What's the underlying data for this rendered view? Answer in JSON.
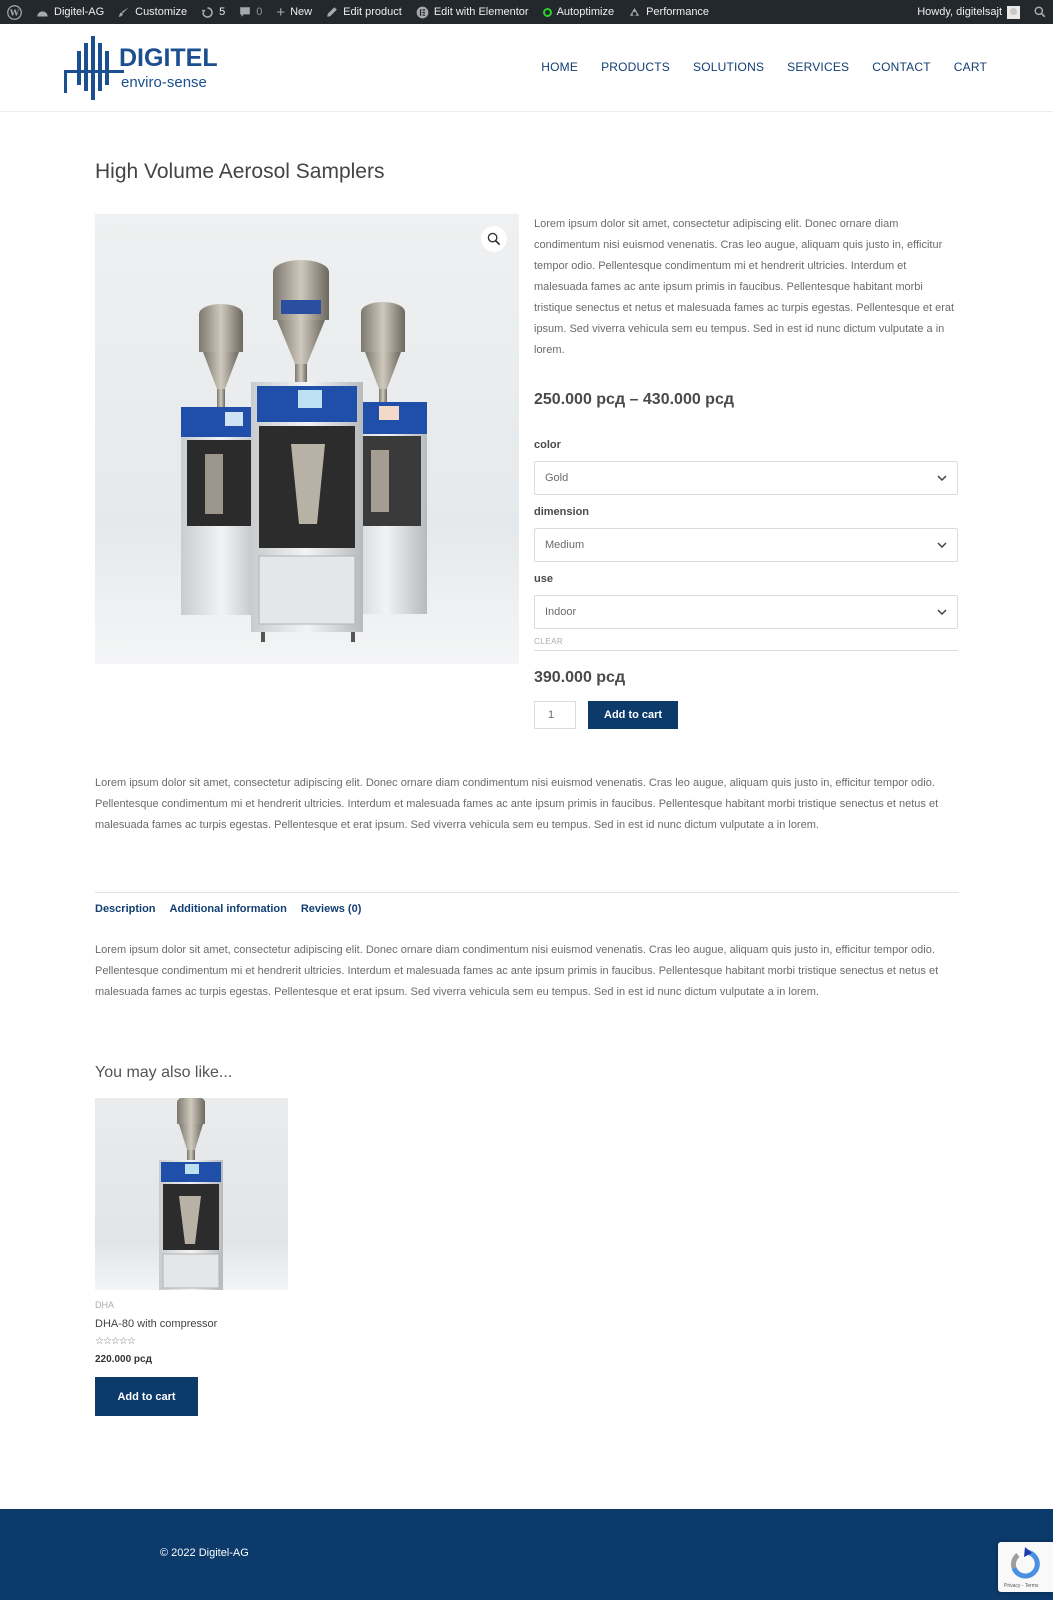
{
  "admin_bar": {
    "site_name": "Digitel-AG",
    "customize": "Customize",
    "updates": "5",
    "comments": "0",
    "new": "New",
    "edit_product": "Edit product",
    "edit_elementor": "Edit with Elementor",
    "autoptimize": "Autoptimize",
    "performance": "Performance",
    "howdy": "Howdy, digitelsajt"
  },
  "logo": {
    "name": "DIGITEL",
    "tagline": "enviro-sense",
    "color": "#1b4f8f"
  },
  "nav": [
    "HOME",
    "PRODUCTS",
    "SOLUTIONS",
    "SERVICES",
    "CONTACT",
    "CART"
  ],
  "product": {
    "title": "High Volume Aerosol Samplers",
    "short_description": "Lorem ipsum dolor sit amet, consectetur adipiscing elit. Donec ornare diam condimentum nisi euismod venenatis. Cras leo augue, aliquam quis justo in, efficitur tempor odio. Pellentesque condimentum mi et hendrerit ultricies. Interdum et malesuada fames ac ante ipsum primis in faucibus. Pellentesque habitant morbi tristique senectus et netus et malesuada fames ac turpis egestas. Pellentesque et erat ipsum. Sed viverra vehicula sem eu tempus. Sed in est id nunc dictum vulputate a in lorem.",
    "price_range": "250.000 рсд – 430.000 рсд",
    "variations": [
      {
        "label": "color",
        "value": "Gold"
      },
      {
        "label": "dimension",
        "value": "Medium"
      },
      {
        "label": "use",
        "value": "Indoor"
      }
    ],
    "clear": "CLEAR",
    "variation_price": "390.000 рсд",
    "quantity": "1",
    "add_to_cart": "Add to cart",
    "long_description": "Lorem ipsum dolor sit amet, consectetur adipiscing elit. Donec ornare diam condimentum nisi euismod venenatis. Cras leo augue, aliquam quis justo in, efficitur tempor odio. Pellentesque condimentum mi et hendrerit ultricies. Interdum et malesuada fames ac ante ipsum primis in faucibus. Pellentesque habitant morbi tristique senectus et netus et malesuada fames ac turpis egestas. Pellentesque et erat ipsum. Sed viverra vehicula sem eu tempus. Sed in est id nunc dictum vulputate a in lorem."
  },
  "tabs": {
    "items": [
      "Description",
      "Additional information",
      "Reviews (0)"
    ],
    "panel_text": "Lorem ipsum dolor sit amet, consectetur adipiscing elit. Donec ornare diam condimentum nisi euismod venenatis. Cras leo augue, aliquam quis justo in, efficitur tempor odio. Pellentesque condimentum mi et hendrerit ultricies. Interdum et malesuada fames ac ante ipsum primis in faucibus. Pellentesque habitant morbi tristique senectus et netus et malesuada fames ac turpis egestas. Pellentesque et erat ipsum. Sed viverra vehicula sem eu tempus. Sed in est id nunc dictum vulputate a in lorem."
  },
  "related": {
    "heading": "You may also like...",
    "product": {
      "category": "DHA",
      "name": "DHA-80 with compressor",
      "rating": 0,
      "stars": "☆☆☆☆☆",
      "price": "220.000 рсд",
      "button": "Add to cart"
    }
  },
  "footer": {
    "copyright": "© 2022 Digitel-AG",
    "background": "#0b3a6b"
  },
  "recaptcha": {
    "text": "Privacy - Terms"
  }
}
